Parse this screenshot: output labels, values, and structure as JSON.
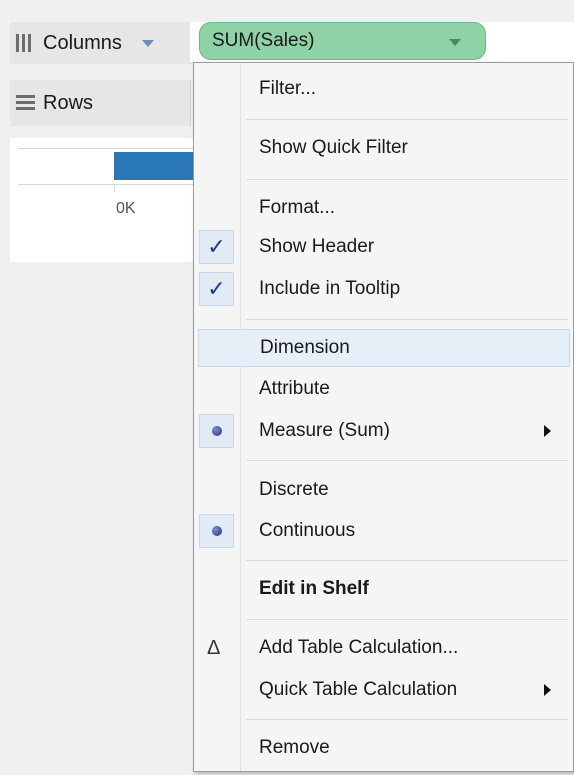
{
  "shelves": {
    "columns_label": "Columns",
    "rows_label": "Rows"
  },
  "pill": {
    "label": "SUM(Sales)",
    "color": "#8fd2a6"
  },
  "view": {
    "axis_tick_label": "0K",
    "bar_color": "#2b78b8"
  },
  "menu": {
    "filter": "Filter...",
    "show_quick_filter": "Show Quick Filter",
    "format": "Format...",
    "show_header": "Show Header",
    "include_in_tooltip": "Include in Tooltip",
    "dimension": "Dimension",
    "attribute": "Attribute",
    "measure_sum": "Measure (Sum)",
    "discrete": "Discrete",
    "continuous": "Continuous",
    "edit_in_shelf": "Edit in Shelf",
    "add_table_calculation": "Add Table Calculation...",
    "quick_table_calculation": "Quick Table Calculation",
    "remove": "Remove",
    "check_glyph": "✓",
    "delta_glyph": "Δ",
    "states": {
      "show_header_checked": true,
      "include_in_tooltip_checked": true,
      "measure_sum_selected": true,
      "continuous_selected": true,
      "hovered_item": "Dimension"
    }
  }
}
